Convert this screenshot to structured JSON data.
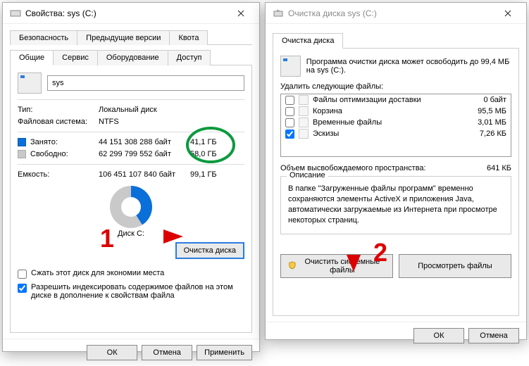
{
  "props": {
    "title": "Свойства: sys (C:)",
    "tabs_row1": [
      "Безопасность",
      "Предыдущие версии",
      "Квота"
    ],
    "tabs_row2": [
      "Общие",
      "Сервис",
      "Оборудование",
      "Доступ"
    ],
    "name": "sys",
    "type_label": "Тип:",
    "type": "Локальный диск",
    "fs_label": "Файловая система:",
    "fs": "NTFS",
    "used_label": "Занято:",
    "used_bytes": "44 151 308 288 байт",
    "used_gb": "41,1 ГБ",
    "free_label": "Свободно:",
    "free_bytes": "62 299 799 552 байт",
    "free_gb": "58,0 ГБ",
    "cap_label": "Емкость:",
    "cap_bytes": "106 451 107 840 байт",
    "cap_gb": "99,1 ГБ",
    "disk_caption": "Диск C:",
    "clean_btn": "Очистка диска",
    "compress": "Сжать этот диск для экономии места",
    "index": "Разрешить индексировать содержимое файлов на этом диске в дополнение к свойствам файла",
    "ok": "ОК",
    "cancel": "Отмена",
    "apply": "Применить"
  },
  "clean": {
    "title": "Очистка диска sys (C:)",
    "tab": "Очистка диска",
    "intro": "Программа очистки диска может освободить до 99,4 МБ на sys (C:).",
    "delete_label": "Удалить следующие файлы:",
    "items": [
      {
        "checked": false,
        "name": "Файлы оптимизации доставки",
        "size": "0 байт"
      },
      {
        "checked": false,
        "name": "Корзина",
        "size": "95,5 МБ"
      },
      {
        "checked": false,
        "name": "Временные файлы",
        "size": "3,01 МБ"
      },
      {
        "checked": true,
        "name": "Эскизы",
        "size": "7,26 КБ"
      }
    ],
    "freed_label": "Объем высвобождаемого пространства:",
    "freed": "641 КБ",
    "desc_title": "Описание",
    "desc": "В папке \"Загруженные файлы программ\" временно сохраняются элементы ActiveX и приложения Java, автоматически загружаемые из Интернета при просмотре некоторых страниц.",
    "sys_btn": "Очистить системные файлы",
    "view_btn": "Просмотреть файлы",
    "ok": "ОК",
    "cancel": "Отмена"
  },
  "annot": {
    "n1": "1",
    "n2": "2"
  }
}
